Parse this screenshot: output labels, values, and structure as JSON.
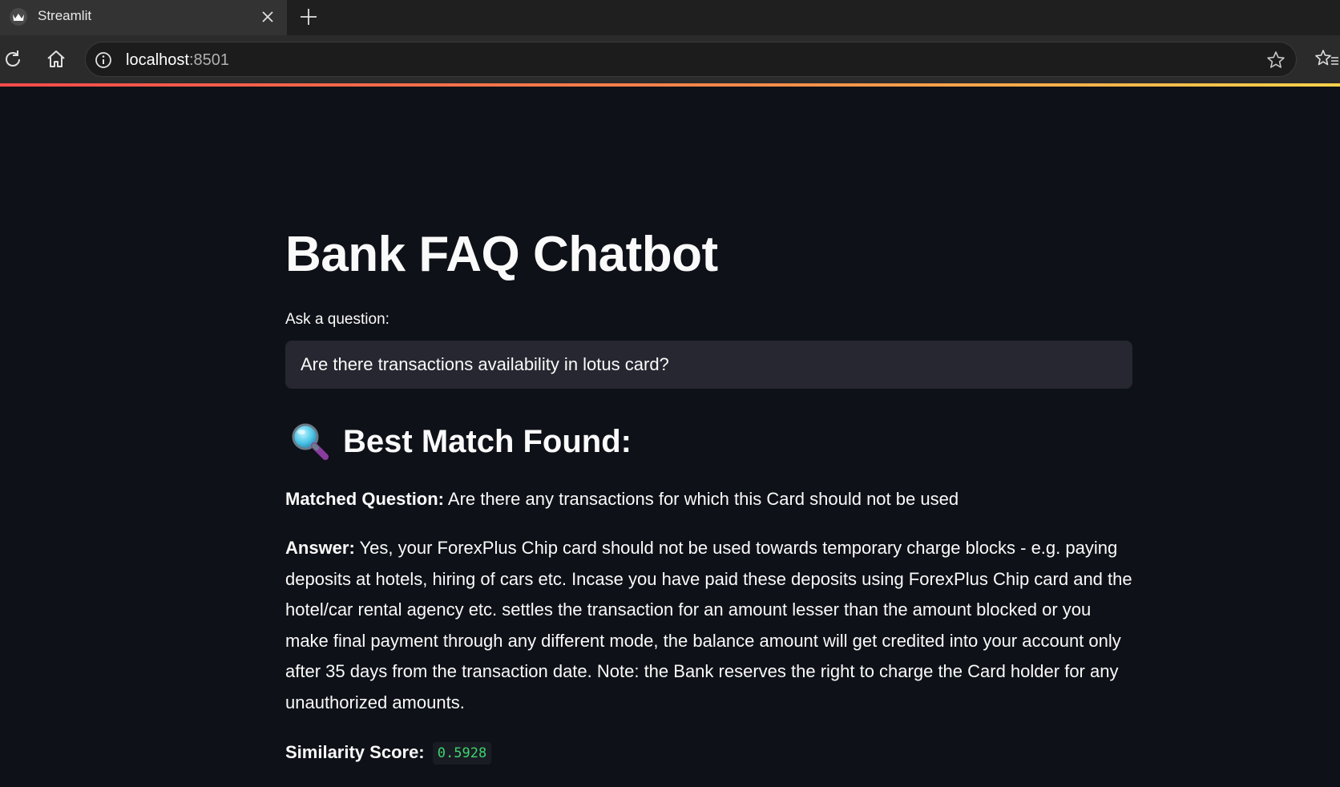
{
  "browser": {
    "tab_title": "Streamlit",
    "url_host": "localhost",
    "url_port": ":8501"
  },
  "app": {
    "title": "Bank FAQ Chatbot",
    "input_label": "Ask a question:",
    "input_value": "Are there transactions availability in lotus card?",
    "result_heading": "Best Match Found:",
    "result_icon": "magnifying-glass-emoji",
    "matched_label": "Matched Question:",
    "matched_value": "Are there any transactions for which this Card should not be used",
    "answer_label": "Answer:",
    "answer_value": "Yes, your ForexPlus Chip card should not be used towards temporary charge blocks - e.g. paying deposits at hotels, hiring of cars etc. Incase you have paid these deposits using ForexPlus Chip card and the hotel/car rental agency etc. settles the transaction for an amount lesser than the amount blocked or you make final payment through any different mode, the balance amount will get credited into your account only after 35 days from the transaction date. Note: the Bank reserves the right to charge the Card holder for any unauthorized amounts.",
    "score_label": "Similarity Score:",
    "score_value": "0.5928"
  },
  "colors": {
    "background": "#0e1117",
    "input_bg": "#262730",
    "score_green": "#3dd56d",
    "accent_start": "#ff4b4b",
    "accent_end": "#ffd24b"
  }
}
